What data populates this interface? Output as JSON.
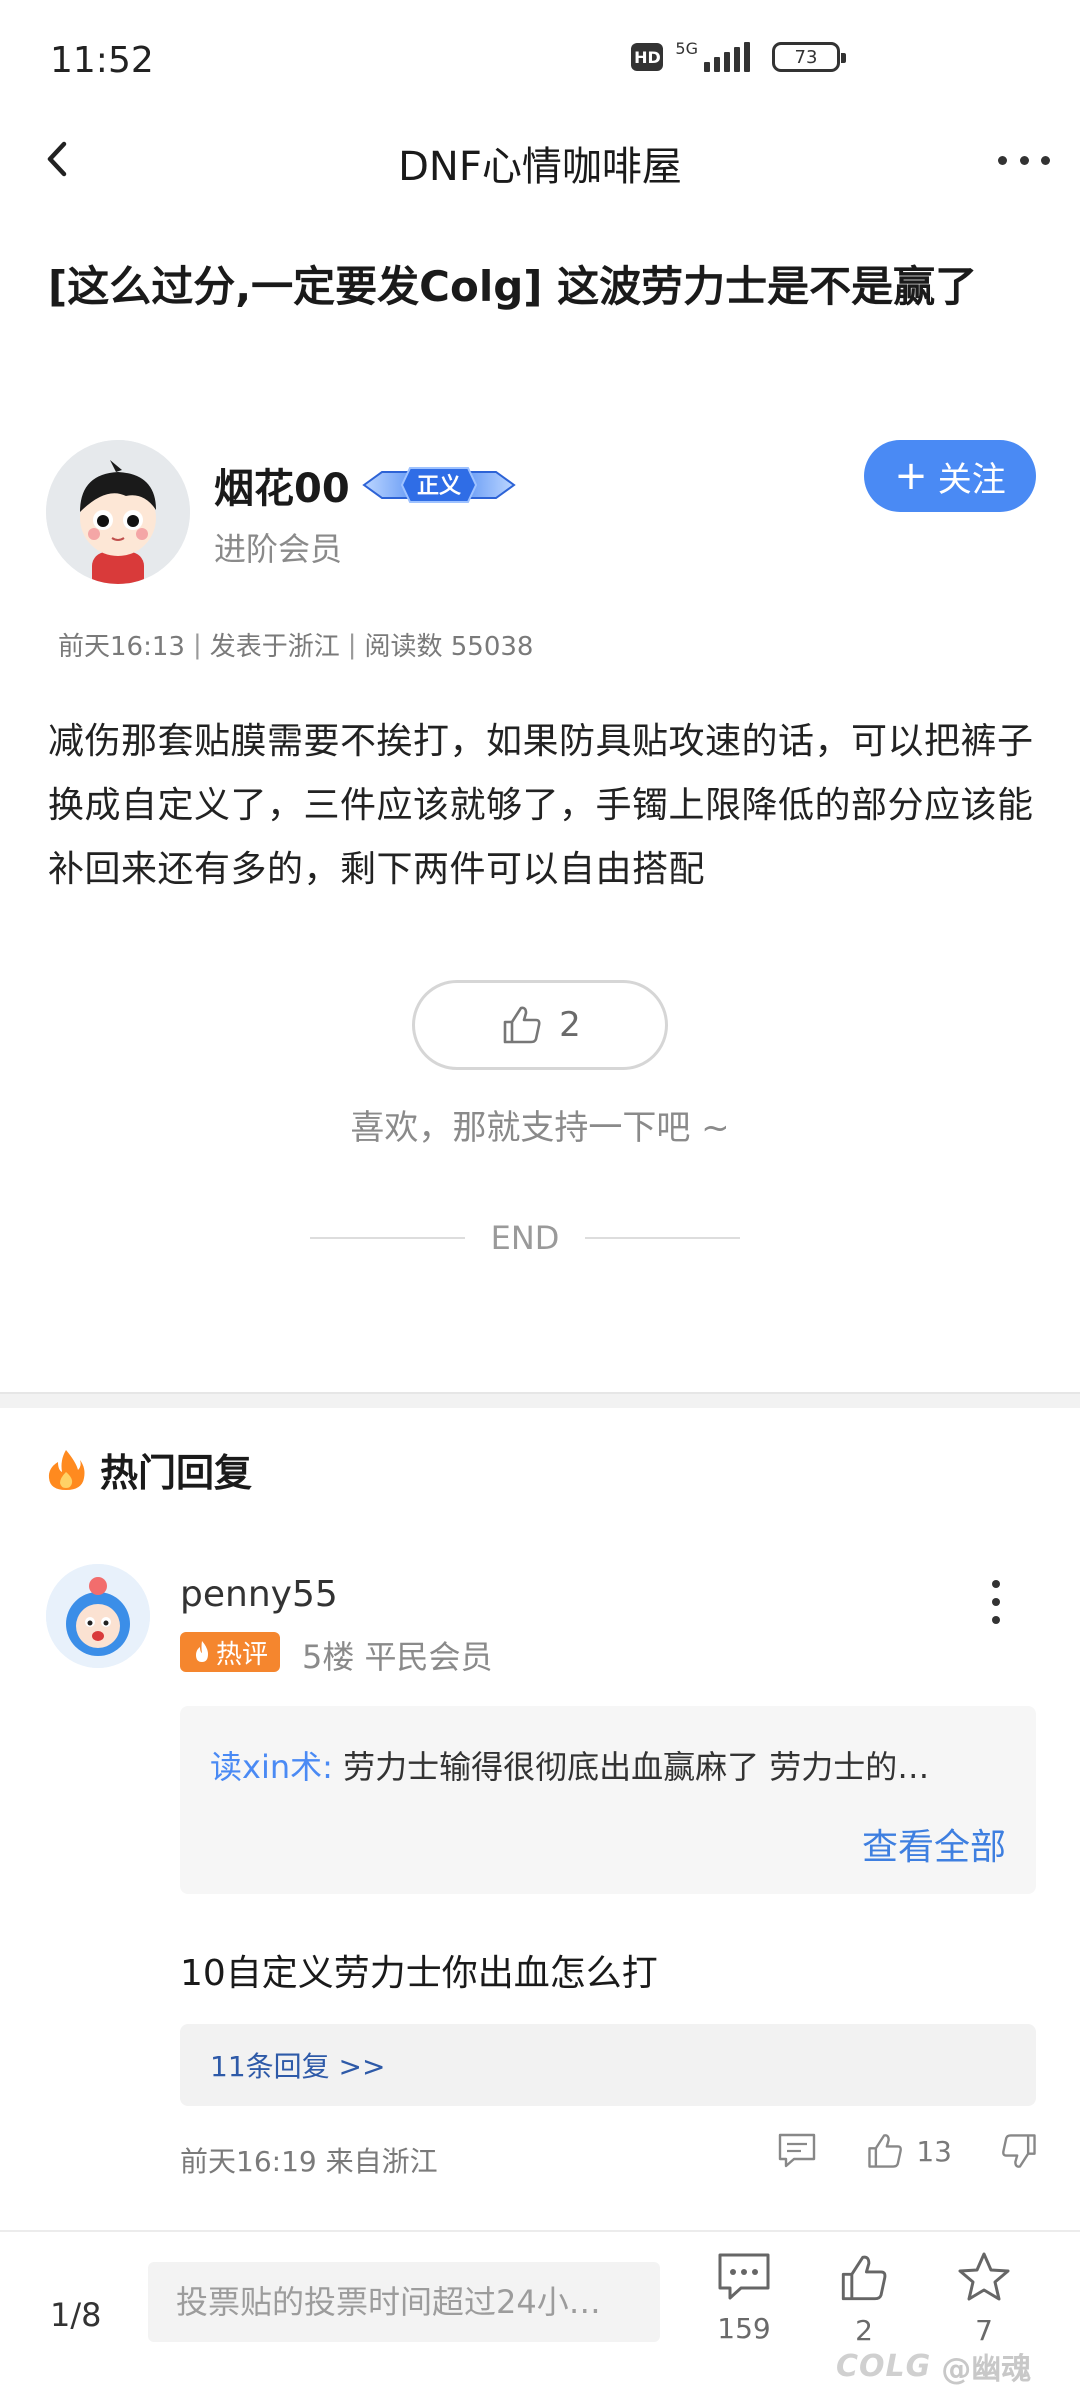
{
  "status": {
    "time": "11:52",
    "hd": "HD",
    "network": "5G",
    "battery": "73"
  },
  "nav": {
    "title": "DNF心情咖啡屋"
  },
  "post": {
    "title": "[这么过分,一定要发Colg] 这波劳力士是不是赢了",
    "author": {
      "name": "烟花00",
      "role": "进阶会员",
      "level_badge": "正义"
    },
    "follow_label": "关注",
    "meta": {
      "time": "前天16:13",
      "location": "发表于浙江",
      "reads": "阅读数 55038"
    },
    "body": "减伤那套贴膜需要不挨打，如果防具贴攻速的话，可以把裤子换成自定义了，三件应该就够了，手镯上限降低的部分应该能补回来还有多的，剩下两件可以自由搭配",
    "likes": "2",
    "like_hint": "喜欢，那就支持一下吧 ~",
    "end_label": "END"
  },
  "hot_replies": {
    "title": "热门回复",
    "comment": {
      "user": "penny55",
      "tag": "热评",
      "meta": "5楼 平民会员",
      "quote_user": "读xin术:",
      "quote_text": "劳力士输得很彻底出血赢麻了  劳力士的…",
      "quote_link": "查看全部",
      "content": "10自定义劳力士你出血怎么打",
      "replies_link": "11条回复 >>",
      "footer": "前天16:19 来自浙江",
      "likes": "13"
    }
  },
  "bottom_bar": {
    "page": "1/8",
    "input_placeholder": "投票贴的投票时间超过24小…",
    "comments": "159",
    "likes": "2",
    "favorites": "7"
  },
  "watermark": {
    "logo": "COLG",
    "text": "@幽魂"
  },
  "colors": {
    "accent": "#4a8af4",
    "hot_tag": "#f5862e",
    "link": "#3e7fe0"
  }
}
